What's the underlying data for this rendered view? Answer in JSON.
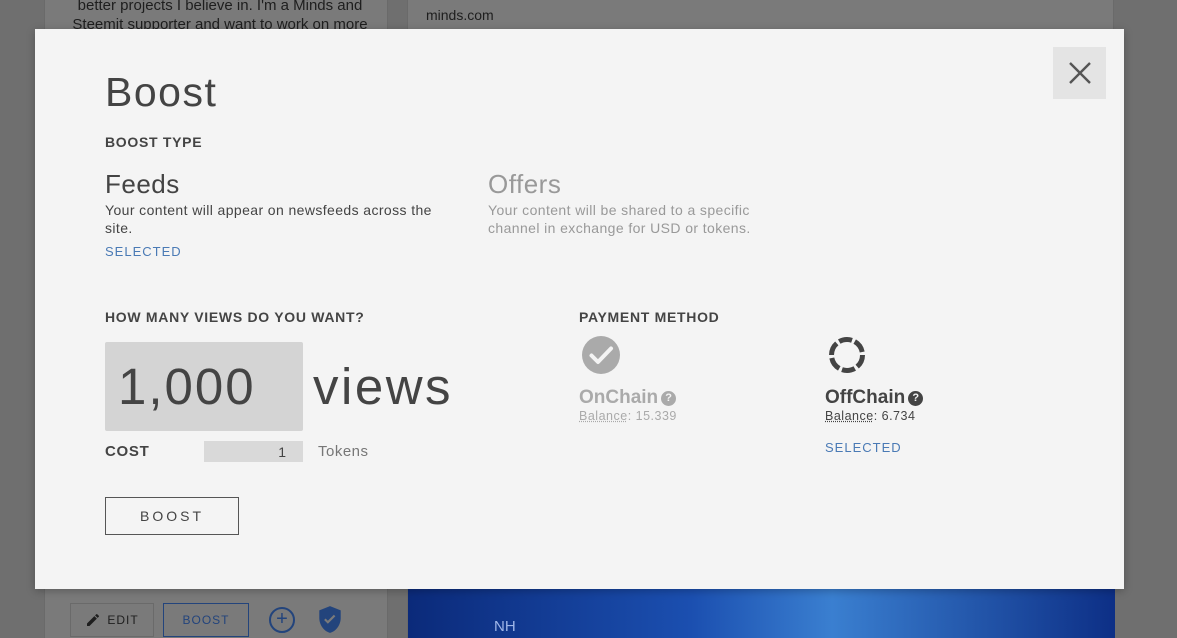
{
  "background": {
    "bio_text": "better projects I believe in. I'm a Minds and\nSteemit supporter and want to work on more",
    "link_text": "minds.com",
    "image_label": "NH",
    "actions": {
      "edit_label": "EDIT",
      "boost_label": "BOOST"
    }
  },
  "modal": {
    "title": "Boost",
    "boost_type_label": "BOOST TYPE",
    "types": [
      {
        "name": "Feeds",
        "description": "Your content will appear on newsfeeds across the site.",
        "status": "SELECTED"
      },
      {
        "name": "Offers",
        "description": "Your content will be shared to a specific channel in exchange for USD or tokens."
      }
    ],
    "views_question": "HOW MANY VIEWS DO YOU WANT?",
    "views_value": "1,000",
    "views_unit": "views",
    "cost_label": "COST",
    "cost_value": "1",
    "cost_unit": "Tokens",
    "boost_button": "BOOST",
    "payment_label": "PAYMENT METHOD",
    "payment_methods": [
      {
        "name": "OnChain",
        "balance_label": "Balance",
        "balance_value": ": 15.339",
        "icon": "check-circle-icon"
      },
      {
        "name": "OffChain",
        "balance_label": "Balance",
        "balance_value": ": 6.734",
        "icon": "ring-icon",
        "status": "SELECTED"
      }
    ],
    "help_glyph": "?"
  },
  "colors": {
    "accent": "#4a7ab5",
    "modal_bg": "#f4f4f4",
    "text": "#444444"
  }
}
